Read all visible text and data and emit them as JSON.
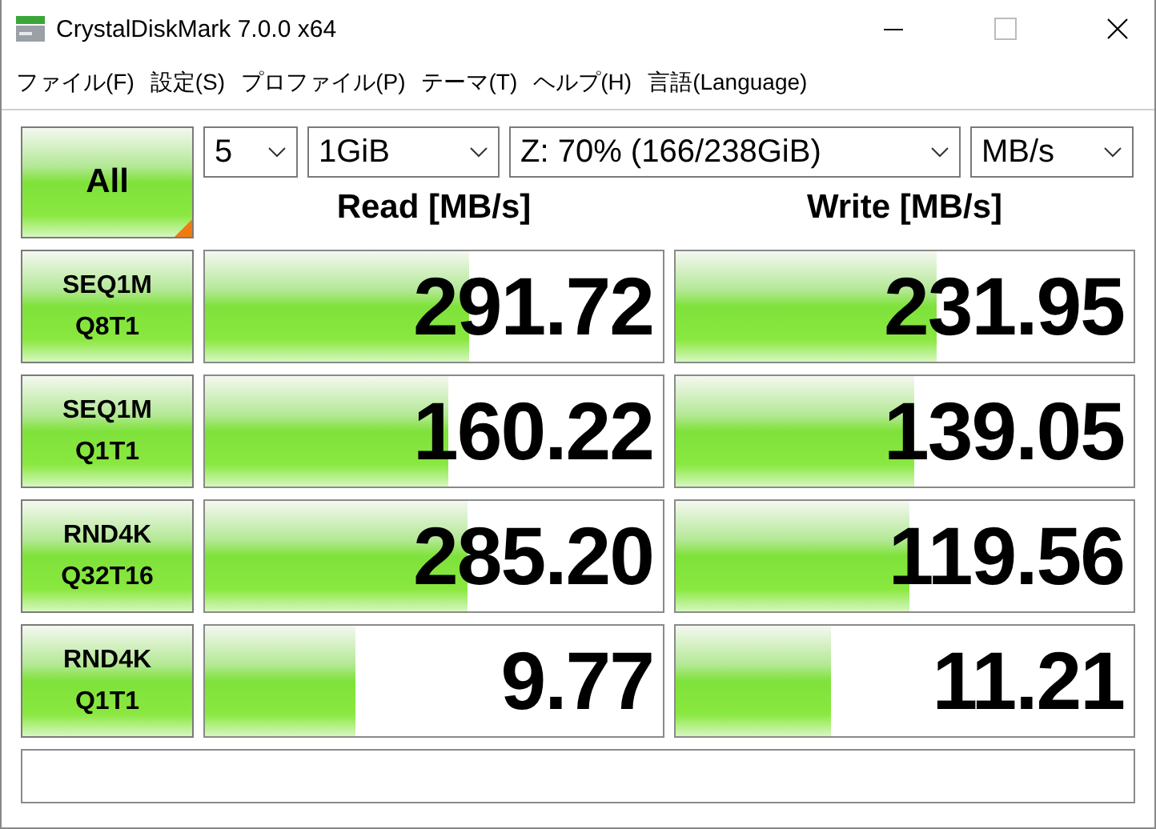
{
  "window": {
    "title": "CrystalDiskMark 7.0.0 x64"
  },
  "menu": [
    "ファイル(F)",
    "設定(S)",
    "プロファイル(P)",
    "テーマ(T)",
    "ヘルプ(H)",
    "言語(Language)"
  ],
  "all_button": {
    "label": "All"
  },
  "selects": [
    {
      "value": "5"
    },
    {
      "value": "1GiB"
    },
    {
      "value": "Z: 70% (166/238GiB)"
    },
    {
      "value": "MB/s"
    }
  ],
  "headers": [
    "Read [MB/s]",
    "Write [MB/s]"
  ],
  "tests": [
    {
      "lines": [
        "SEQ1M",
        "Q8T1"
      ],
      "read": {
        "value": "291.72",
        "level": 0.576
      },
      "write": {
        "value": "231.95",
        "level": 0.57
      }
    },
    {
      "lines": [
        "SEQ1M",
        "Q1T1"
      ],
      "read": {
        "value": "160.22",
        "level": 0.53
      },
      "write": {
        "value": "139.05",
        "level": 0.52
      }
    },
    {
      "lines": [
        "RND4K",
        "Q32T16"
      ],
      "read": {
        "value": "285.20",
        "level": 0.573
      },
      "write": {
        "value": "119.56",
        "level": 0.51
      }
    },
    {
      "lines": [
        "RND4K",
        "Q1T1"
      ],
      "read": {
        "value": "9.77",
        "level": 0.33
      },
      "write": {
        "value": "11.21",
        "level": 0.34
      }
    }
  ]
}
